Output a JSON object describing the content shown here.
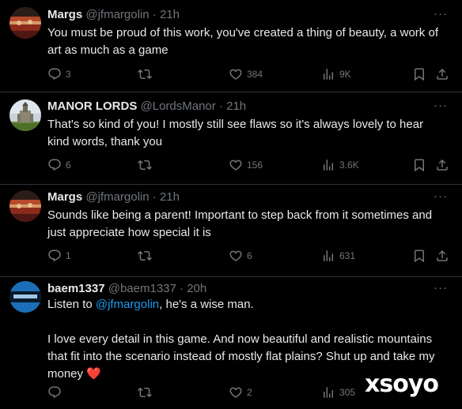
{
  "tweets": [
    {
      "name": "Margs",
      "handle": "@jfmargolin",
      "time": "21h",
      "lines": [
        "You must be proud of this work, you've created a thing of beauty, a work of",
        "art as much as a game"
      ],
      "replies": "3",
      "likes": "384",
      "views": "9K"
    },
    {
      "name": "MANOR LORDS",
      "handle": "@LordsManor",
      "time": "21h",
      "lines": [
        "That's so kind of you! I mostly still see flaws so it's always lovely to hear",
        "kind words, thank you"
      ],
      "replies": "6",
      "likes": "156",
      "views": "3.6K"
    },
    {
      "name": "Margs",
      "handle": "@jfmargolin",
      "time": "21h",
      "lines": [
        "Sounds like being a parent! Important to step back from it sometimes and",
        "just appreciate how special it is"
      ],
      "replies": "1",
      "likes": "6",
      "views": "631"
    },
    {
      "name": "baem1337",
      "handle": "@baem1337",
      "time": "20h",
      "line1_prefix": "Listen to ",
      "line1_mention": "@jfmargolin",
      "line1_suffix": ", he's a wise man.",
      "para2": [
        "I love every detail in this game. And now beautiful and realistic mountains",
        "that fit into the scenario instead of mostly flat plains? Shut up and take my",
        "money"
      ],
      "emoji": "❤️",
      "replies": "",
      "likes": "2",
      "views": "305"
    }
  ],
  "dot": "·",
  "more_glyph": "···",
  "watermark": "xsoyo",
  "colors": {
    "background": "#000000",
    "text": "#e7e9ea",
    "muted": "#71767b",
    "link": "#1d9bf0",
    "divider": "#2f3336",
    "heart": "#f91880"
  },
  "icons": [
    "reply-icon",
    "retweet-icon",
    "like-icon",
    "views-icon",
    "bookmark-icon",
    "share-icon",
    "more-icon"
  ]
}
